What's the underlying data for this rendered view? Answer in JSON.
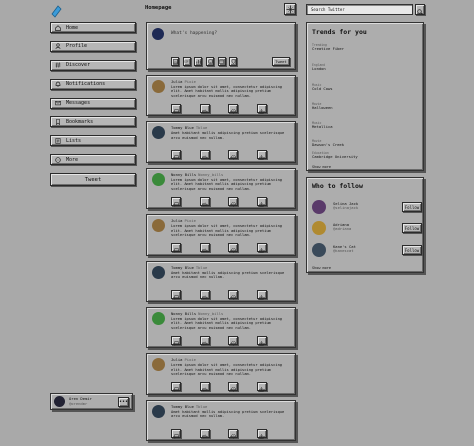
{
  "brand": {
    "logo_icon": "tweeter-logo-icon",
    "accent": "#3a9bd9"
  },
  "nav": {
    "items": [
      {
        "label": "Home",
        "icon": "home-icon"
      },
      {
        "label": "Profile",
        "icon": "user-icon"
      },
      {
        "label": "Discover",
        "icon": "hash-icon"
      },
      {
        "label": "Notifications",
        "icon": "bell-icon"
      },
      {
        "label": "Messages",
        "icon": "mail-icon"
      },
      {
        "label": "Bookmarks",
        "icon": "bookmark-icon"
      },
      {
        "label": "Lists",
        "icon": "list-icon"
      },
      {
        "label": "More",
        "icon": "more-icon"
      }
    ],
    "tweet_button": "Tweet"
  },
  "current_user": {
    "name": "Oren Demir",
    "handle": "@orendmr",
    "more": "•••"
  },
  "header": {
    "title": "Homepage",
    "compose_icon": "sparkle-icon"
  },
  "search": {
    "placeholder": "Search Twitter"
  },
  "compose": {
    "placeholder": "What's happening?",
    "submit": "Tweet",
    "tools": [
      "image-icon",
      "gif-icon",
      "poll-icon",
      "emoji-icon",
      "schedule-icon",
      "location-icon"
    ]
  },
  "tweets": [
    {
      "name": "Julia",
      "handle": "Pixie",
      "text": "Lorem ipsum dolor sit amet, consectetur adipiscing elit. Amet habitant mollis adipiscing pretium scelerisque arcu euismod nec nullam.",
      "avatar": "#8a6a3a"
    },
    {
      "name": "Tommy Blue",
      "handle": "Tblue",
      "text": "Amet habitant mollis adipiscing pretium scelerisque arcu euismod nec nullam.",
      "avatar": "#2a3a4a"
    },
    {
      "name": "Nonny Bills",
      "handle": "Nonny_bills",
      "text": "Lorem ipsum dolor sit amet, consectetur adipiscing elit. Amet habitant mollis adipiscing pretium scelerisque arcu euismod nec nullam.",
      "avatar": "#3a8a3a"
    },
    {
      "name": "Julia",
      "handle": "Pixie",
      "text": "Lorem ipsum dolor sit amet, consectetur adipiscing elit. Amet habitant mollis adipiscing pretium scelerisque arcu euismod nec nullam.",
      "avatar": "#8a6a3a"
    },
    {
      "name": "Tommy Blue",
      "handle": "Tblue",
      "text": "Amet habitant mollis adipiscing pretium scelerisque arcu euismod nec nullam.",
      "avatar": "#2a3a4a"
    },
    {
      "name": "Nonny Bills",
      "handle": "Nonny_bills",
      "text": "Lorem ipsum dolor sit amet, consectetur adipiscing elit. Amet habitant mollis adipiscing pretium scelerisque arcu euismod nec nullam.",
      "avatar": "#3a8a3a"
    },
    {
      "name": "Julia",
      "handle": "Pixie",
      "text": "Lorem ipsum dolor sit amet, consectetur adipiscing elit. Amet habitant mollis adipiscing pretium scelerisque arcu euismod nec nullam.",
      "avatar": "#8a6a3a"
    },
    {
      "name": "Tommy Blue",
      "handle": "Tblue",
      "text": "Amet habitant mollis adipiscing pretium scelerisque arcu euismod nec nullam.",
      "avatar": "#2a3a4a"
    }
  ],
  "tweet_actions": [
    "reply-icon",
    "retweet-icon",
    "like-icon",
    "share-icon"
  ],
  "trends": {
    "title": "Trends for you",
    "items": [
      {
        "category": "Trending",
        "label": "Creative Fiber"
      },
      {
        "category": "England",
        "label": "London"
      },
      {
        "category": "Music",
        "label": "Cold Cows"
      },
      {
        "category": "Movie",
        "label": "Halloween"
      },
      {
        "category": "Music",
        "label": "Metallica"
      },
      {
        "category": "Movie",
        "label": "Dawson's Creek"
      },
      {
        "category": "Education",
        "label": "Cambridge University"
      }
    ],
    "more": "Show more"
  },
  "who_to_follow": {
    "title": "Who to follow",
    "items": [
      {
        "name": "Selina Jack",
        "handle": "@selinajack",
        "button": "Follow",
        "avatar": "#5a3a6a"
      },
      {
        "name": "Adriana",
        "handle": "@adriana",
        "button": "Follow",
        "avatar": "#b08a30"
      },
      {
        "name": "Kane's Cat",
        "handle": "@kanescat",
        "button": "Follow",
        "avatar": "#3a4a5a"
      }
    ],
    "more": "Show more"
  }
}
